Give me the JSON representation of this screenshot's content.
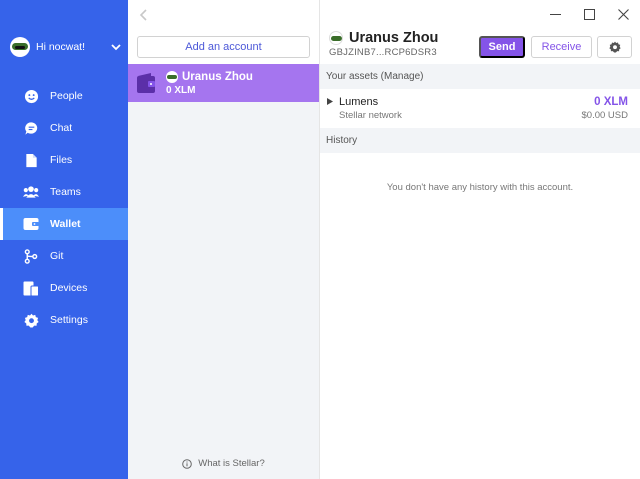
{
  "sidebar": {
    "username": "Hi nocwat!",
    "items": [
      {
        "label": "People",
        "icon": "people-icon"
      },
      {
        "label": "Chat",
        "icon": "chat-icon"
      },
      {
        "label": "Files",
        "icon": "files-icon"
      },
      {
        "label": "Teams",
        "icon": "teams-icon"
      },
      {
        "label": "Wallet",
        "icon": "wallet-icon",
        "active": true
      },
      {
        "label": "Git",
        "icon": "git-icon"
      },
      {
        "label": "Devices",
        "icon": "devices-icon"
      },
      {
        "label": "Settings",
        "icon": "settings-icon"
      }
    ],
    "bg_color": "#3663ea",
    "active_color": "#4c8efa"
  },
  "accounts": {
    "add_account_label": "Add an account",
    "selected_account": {
      "name": "Uranus Zhou",
      "balance": "0 XLM"
    },
    "what_is_stellar": "What is Stellar?",
    "selected_color": "#a575ef"
  },
  "detail": {
    "title": "Uranus Zhou",
    "address": "GBJZINB7...RCP6DSR3",
    "send_label": "Send",
    "receive_label": "Receive",
    "assets_header": "Your assets (Manage)",
    "assets": [
      {
        "name": "Lumens",
        "network": "Stellar network",
        "amount": "0 XLM",
        "usd": "$0.00 USD"
      }
    ],
    "history_header": "History",
    "history_empty": "You don't have any history with this account.",
    "accent_color": "#8454e8"
  }
}
